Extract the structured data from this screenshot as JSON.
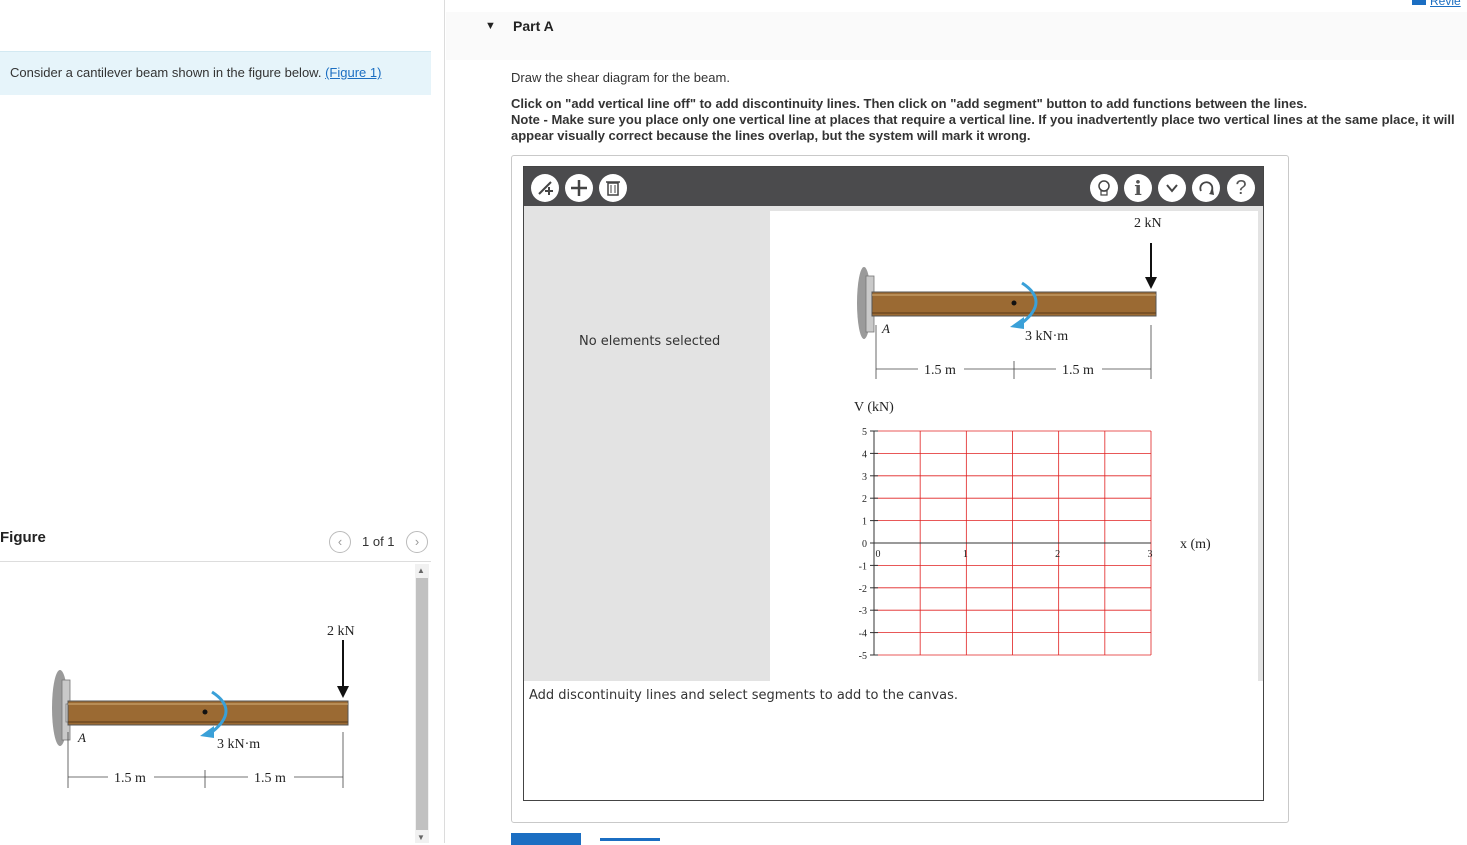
{
  "problem": {
    "intro_text": "Consider a cantilever beam shown in the figure below.",
    "figure_link": "(Figure 1)"
  },
  "figure_panel": {
    "title": "Figure",
    "pager": "1 of 1",
    "prev_icon": "chevron-left-icon",
    "next_icon": "chevron-right-icon"
  },
  "part": {
    "title": "Part A",
    "review_label": "Revie",
    "question": "Draw the shear diagram for the beam.",
    "instructions": [
      "Click on \"add vertical line off\" to add discontinuity lines. Then click on \"add segment\" button to add functions between the lines.",
      "Note - Make sure you place only one vertical line at places that require a vertical line. If you inadvertently place two vertical lines at the same place, it will appear visually correct because the lines overlap, but the system will mark it wrong."
    ]
  },
  "toolbar": {
    "left_tools": [
      "add-vertical-line-icon",
      "add-segment-icon",
      "delete-icon"
    ],
    "right_tools": [
      "hint-icon",
      "info-icon",
      "dropdown-icon",
      "reset-icon",
      "help-icon"
    ],
    "info_glyph": "i",
    "help_glyph": "?"
  },
  "side_panel": {
    "message": "No elements selected"
  },
  "status": {
    "message": "Add discontinuity lines and select segments to add to the canvas."
  },
  "beam": {
    "load_label": "2 kN",
    "moment_label": "3 kN·m",
    "support_label": "A",
    "span1": "1.5 m",
    "span2": "1.5 m"
  },
  "shear_chart": {
    "ylabel": "V (kN)",
    "xlabel": "x (m)",
    "y_ticks": [
      "5",
      "4",
      "3",
      "2",
      "1",
      "0",
      "-1",
      "-2",
      "-3",
      "-4",
      "-5"
    ],
    "x_ticks": [
      "0",
      "1",
      "2",
      "3"
    ],
    "grid_color": "#e02020"
  }
}
